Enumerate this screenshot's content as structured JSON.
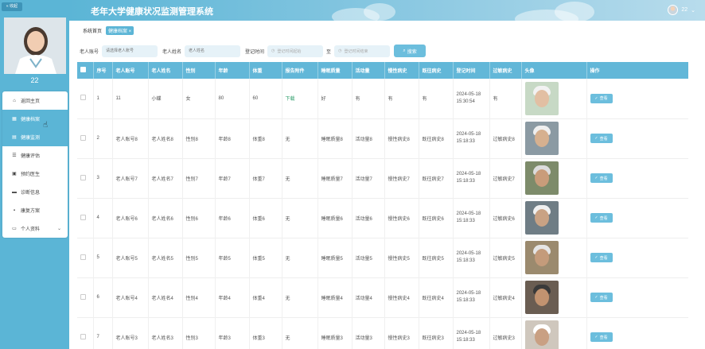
{
  "header": {
    "title": "老年大学健康状况监测管理系统",
    "username": "22"
  },
  "sidebar": {
    "collapse_label": "« 收起",
    "user_name": "22",
    "items": [
      {
        "label": "返回主页",
        "icon": "home-icon",
        "active": false
      },
      {
        "label": "健康档案",
        "icon": "folder-icon",
        "active": true
      },
      {
        "label": "健康监测",
        "icon": "monitor-icon",
        "active": true
      },
      {
        "label": "健康评估",
        "icon": "list-icon",
        "active": false
      },
      {
        "label": "预约医生",
        "icon": "calendar-icon",
        "active": false
      },
      {
        "label": "诊断信息",
        "icon": "diagnosis-icon",
        "active": false
      },
      {
        "label": "康复方案",
        "icon": "plan-icon",
        "active": false
      },
      {
        "label": "个人资料",
        "icon": "user-icon",
        "active": false,
        "has_chevron": true
      }
    ]
  },
  "breadcrumb": {
    "home": "系统首页",
    "current": "健康档案 ×"
  },
  "search": {
    "label_account": "老人账号",
    "placeholder_account": "请选择老人账号",
    "label_name": "老人姓名",
    "placeholder_name": "老人姓名",
    "label_time": "登记时间",
    "placeholder_start": "登记时间起始",
    "separator": "至",
    "placeholder_end": "登记时间结束",
    "button": "搜索"
  },
  "table": {
    "headers": [
      "序号",
      "老人账号",
      "老人姓名",
      "性别",
      "年龄",
      "体重",
      "报告附件",
      "睡眠质量",
      "活动量",
      "慢性病史",
      "既往病史",
      "登记时间",
      "过敏病史",
      "头像",
      "操作"
    ],
    "view_label": "查看",
    "rows": [
      {
        "idx": "1",
        "account": "11",
        "name": "小蝶",
        "gender": "女",
        "age": "80",
        "weight": "60",
        "attach": "下载",
        "sleep": "好",
        "activity": "有",
        "chronic": "有",
        "history": "有",
        "date": "2024-05-18",
        "time": "15:30:54",
        "allergy": "有"
      },
      {
        "idx": "2",
        "account": "老人账号8",
        "name": "老人姓名8",
        "gender": "性别8",
        "age": "年龄8",
        "weight": "体重8",
        "attach": "无",
        "sleep": "睡眠质量8",
        "activity": "活动量8",
        "chronic": "慢性病史8",
        "history": "既往病史8",
        "date": "2024-05-18",
        "time": "15:18:33",
        "allergy": "过敏病史8"
      },
      {
        "idx": "3",
        "account": "老人账号7",
        "name": "老人姓名7",
        "gender": "性别7",
        "age": "年龄7",
        "weight": "体重7",
        "attach": "无",
        "sleep": "睡眠质量7",
        "activity": "活动量7",
        "chronic": "慢性病史7",
        "history": "既往病史7",
        "date": "2024-05-18",
        "time": "15:18:33",
        "allergy": "过敏病史7"
      },
      {
        "idx": "4",
        "account": "老人账号6",
        "name": "老人姓名6",
        "gender": "性别6",
        "age": "年龄6",
        "weight": "体重6",
        "attach": "无",
        "sleep": "睡眠质量6",
        "activity": "活动量6",
        "chronic": "慢性病史6",
        "history": "既往病史6",
        "date": "2024-05-18",
        "time": "15:18:33",
        "allergy": "过敏病史6"
      },
      {
        "idx": "5",
        "account": "老人账号5",
        "name": "老人姓名5",
        "gender": "性别5",
        "age": "年龄5",
        "weight": "体重5",
        "attach": "无",
        "sleep": "睡眠质量5",
        "activity": "活动量5",
        "chronic": "慢性病史5",
        "history": "既往病史5",
        "date": "2024-05-18",
        "time": "15:18:33",
        "allergy": "过敏病史5"
      },
      {
        "idx": "6",
        "account": "老人账号4",
        "name": "老人姓名4",
        "gender": "性别4",
        "age": "年龄4",
        "weight": "体重4",
        "attach": "无",
        "sleep": "睡眠质量4",
        "activity": "活动量4",
        "chronic": "慢性病史4",
        "history": "既往病史4",
        "date": "2024-05-18",
        "time": "15:18:33",
        "allergy": "过敏病史4"
      },
      {
        "idx": "7",
        "account": "老人账号3",
        "name": "老人姓名3",
        "gender": "性别3",
        "age": "年龄3",
        "weight": "体重3",
        "attach": "无",
        "sleep": "睡眠质量3",
        "activity": "活动量3",
        "chronic": "慢性病史3",
        "history": "既往病史3",
        "date": "2024-05-18",
        "time": "15:18:33",
        "allergy": "过敏病史3"
      }
    ]
  },
  "colors": {
    "accent": "#5bb5d6",
    "header_bg": "#62b7d8",
    "button": "#6cbedd",
    "download_link": "#2e9e6b"
  }
}
